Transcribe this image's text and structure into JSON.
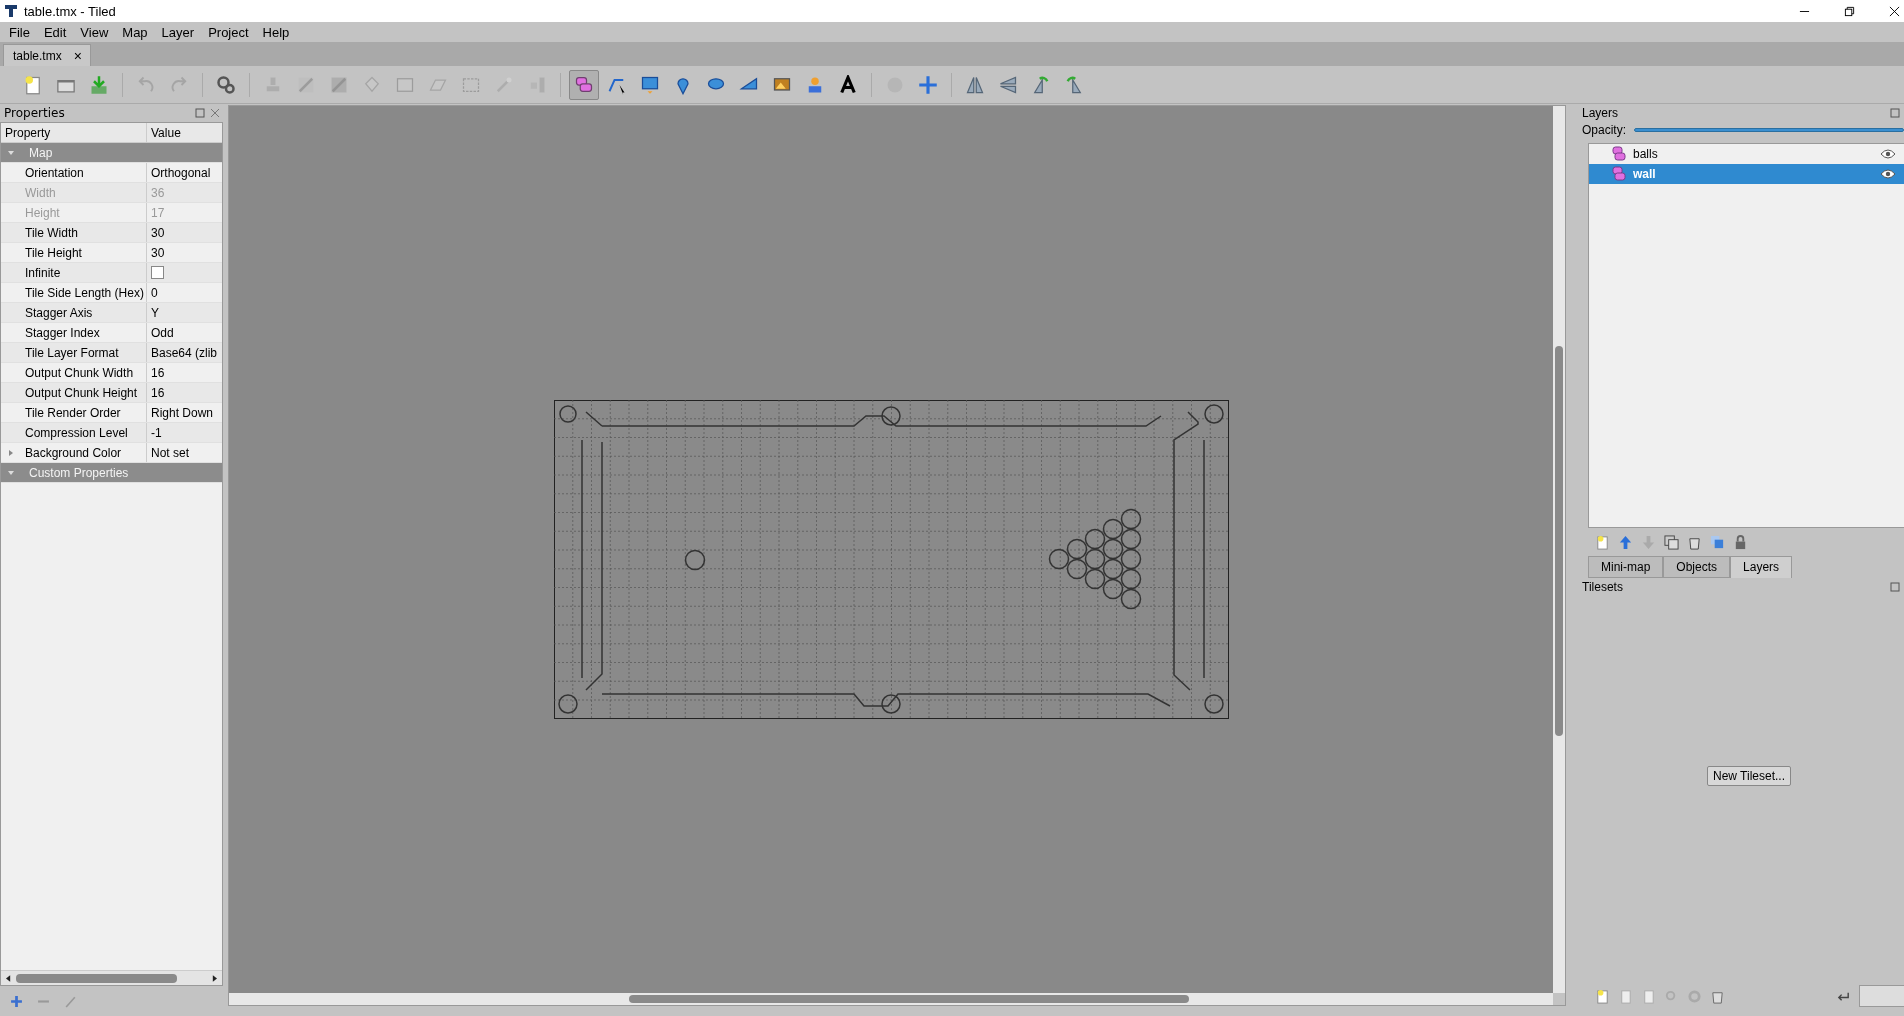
{
  "window": {
    "title": "table.tmx - Tiled"
  },
  "menu": [
    "File",
    "Edit",
    "View",
    "Map",
    "Layer",
    "Project",
    "Help"
  ],
  "document_tabs": [
    {
      "label": "table.tmx",
      "close": "×",
      "selected": true
    }
  ],
  "toolbar": [
    {
      "selected": false,
      "disabled": false
    },
    {
      "selected": false,
      "disabled": false
    },
    {
      "selected": false,
      "disabled": false
    },
    {
      "selected": false,
      "disabled": true
    },
    {
      "selected": false,
      "disabled": true
    },
    {
      "selected": false,
      "disabled": false
    },
    {
      "selected": false,
      "disabled": true
    },
    {
      "selected": false,
      "disabled": true
    },
    {
      "selected": false,
      "disabled": true
    },
    {
      "selected": false,
      "disabled": true
    },
    {
      "selected": false,
      "disabled": true
    },
    {
      "selected": false,
      "disabled": true
    },
    {
      "selected": false,
      "disabled": true
    },
    {
      "selected": false,
      "disabled": true
    },
    {
      "selected": false,
      "disabled": true
    },
    {
      "selected": true,
      "disabled": false
    },
    {
      "selected": false,
      "disabled": false
    },
    {
      "selected": false,
      "disabled": false
    },
    {
      "selected": false,
      "disabled": false
    },
    {
      "selected": false,
      "disabled": false
    },
    {
      "selected": false,
      "disabled": false
    },
    {
      "selected": false,
      "disabled": false
    },
    {
      "selected": false,
      "disabled": false
    },
    {
      "selected": false,
      "disabled": false
    },
    {
      "selected": false,
      "disabled": true
    },
    {
      "selected": false,
      "disabled": false
    },
    {
      "selected": false,
      "disabled": false
    },
    {
      "selected": false,
      "disabled": false
    },
    {
      "selected": false,
      "disabled": false
    },
    {
      "selected": false,
      "disabled": false
    }
  ],
  "properties": {
    "title": "Properties",
    "columns": [
      "Property",
      "Value"
    ],
    "groups": [
      {
        "label": "Map",
        "expanded": true,
        "rows": [
          {
            "name": "Orientation",
            "value": "Orthogonal",
            "kind": "text",
            "disabled": false
          },
          {
            "name": "Width",
            "value": "36",
            "kind": "text",
            "disabled": true
          },
          {
            "name": "Height",
            "value": "17",
            "kind": "text",
            "disabled": true
          },
          {
            "name": "Tile Width",
            "value": "30",
            "kind": "text",
            "disabled": false
          },
          {
            "name": "Tile Height",
            "value": "30",
            "kind": "text",
            "disabled": false
          },
          {
            "name": "Infinite",
            "checked": false,
            "kind": "checkbox",
            "disabled": false
          },
          {
            "name": "Tile Side Length (Hex)",
            "value": "0",
            "kind": "text",
            "disabled": false
          },
          {
            "name": "Stagger Axis",
            "value": "Y",
            "kind": "text",
            "disabled": false
          },
          {
            "name": "Stagger Index",
            "value": "Odd",
            "kind": "text",
            "disabled": false
          },
          {
            "name": "Tile Layer Format",
            "value": "Base64 (zlib",
            "kind": "text",
            "disabled": false
          },
          {
            "name": "Output Chunk Width",
            "value": "16",
            "kind": "text",
            "disabled": false
          },
          {
            "name": "Output Chunk Height",
            "value": "16",
            "kind": "text",
            "disabled": false
          },
          {
            "name": "Tile Render Order",
            "value": "Right Down",
            "kind": "text",
            "disabled": false
          },
          {
            "name": "Compression Level",
            "value": "-1",
            "kind": "text",
            "disabled": false
          },
          {
            "name": "Background Color",
            "value": "Not set",
            "kind": "expander",
            "expanded": false,
            "disabled": false
          }
        ]
      },
      {
        "label": "Custom Properties",
        "expanded": true
      }
    ]
  },
  "layers_panel": {
    "title": "Layers",
    "opacity_label": "Opacity:",
    "opacity": {
      "level": 1.0
    },
    "layers": [
      {
        "name": "balls",
        "selected": false,
        "visible": true
      },
      {
        "name": "wall",
        "selected": true,
        "visible": true
      }
    ]
  },
  "dock_tabs": [
    {
      "label": "Mini-map",
      "selected": false
    },
    {
      "label": "Objects",
      "selected": false
    },
    {
      "label": "Layers",
      "selected": true
    }
  ],
  "tilesets_panel": {
    "title": "Tilesets",
    "button": "New Tileset..."
  }
}
